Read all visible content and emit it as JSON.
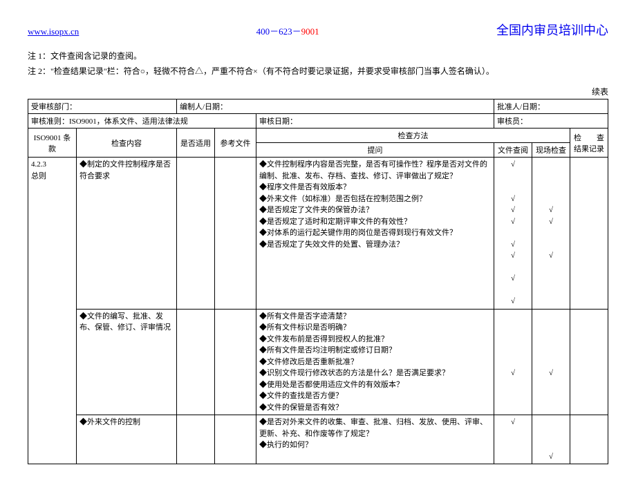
{
  "header": {
    "url": "www.isopx.cn",
    "phone_parts": [
      "400",
      "623",
      "9001"
    ],
    "title": "全国内审员培训中心"
  },
  "notes": {
    "n1": "注 1：文件查阅含记录的查阅。",
    "n2": "注 2：\"检查结果记录\"栏：符合○，轻微不符合△，严重不符合×（有不符合时要记录证据，并要求受审核部门当事人签名确认）。"
  },
  "cont_label": "续表",
  "meta_row1": {
    "dept_label": "受审核部门：",
    "prepared_label": "编制人/日期：",
    "approved_label": "批准人/日期："
  },
  "meta_row2": {
    "criteria_label_full": "审核准则：ISO9001，体系文件、适用法律法规",
    "date_label": "审核日期：",
    "auditor_label": "审核员："
  },
  "headers": {
    "clause": "ISO9001 条款",
    "content": "检查内容",
    "applicable": "是否适用",
    "reference": "参考文件",
    "method": "检查方法",
    "question": "提问",
    "doc_review": "文件查阅",
    "site_check": "现场检查",
    "result": "检　　查结果记录"
  },
  "row_4_2_3": {
    "clause": "4.2.3\n总则",
    "block1": {
      "content": "◆制定的文件控制程序是否符合要求",
      "questions": "◆文件控制程序内容是否完整，是否有可操作性？程序是否对文件的编制、批准、发布、存档、查找、修订、评审做出了规定？\n◆程序文件是否有效版本？\n◆外来文件（如标准）是否包括在控制范围之例？\n◆是否规定了文件夹的保管办法？\n◆是否规定了适时和定期评审文件的有效性？\n◆对体系的运行起关键作用的岗位是否得到现行有效文件？\n◆是否规定了失效文件的处置、管理办法？",
      "doc_marks": "√\n\n\n√\n√\n√\n\n√\n√\n\n√\n\n√",
      "site_marks": "\n\n\n\n√\n√\n\n\n√\n\n\n\n"
    },
    "block2": {
      "content": "◆文件的编写、批准、发布、保管、修订、评审情况",
      "questions": "◆所有文件是否字迹清楚？\n◆所有文件标识是否明确？\n◆文件发布前是否得到授权人的批准？\n◆所有文件是否均注明制定或修订日期？\n◆文件修改后是否重新批准？\n◆识别文件现行修改状态的方法是什么？是否满足要求？\n◆使用处是否都使用适应文件的有效版本？\n◆文件的查找是否方便？\n◆文件的保管是否有效？",
      "doc_marks": "\n\n\n\n\n√",
      "site_marks": "\n\n\n\n\n√"
    },
    "block3": {
      "content": "◆外来文件的控制",
      "questions": "◆是否对外来文件的收集、审查、批准、归档、发放、使用、评审、更新、补充、和作废等作了规定？\n◆执行的如何？",
      "doc_marks": "√",
      "site_marks": "\n\n\n√"
    }
  }
}
